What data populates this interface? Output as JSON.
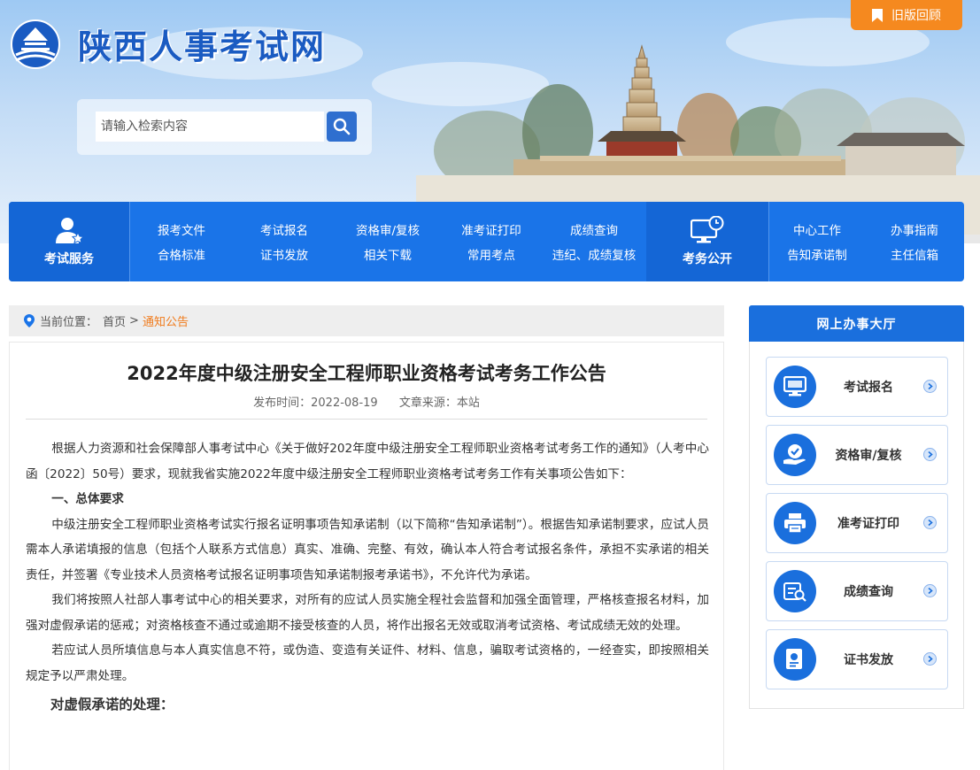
{
  "header": {
    "site_title": "陕西人事考试网",
    "old_version_label": "旧版回顾",
    "search": {
      "placeholder": "请输入检索内容",
      "value": ""
    }
  },
  "nav": {
    "exam_service_label": "考试服务",
    "exam_affairs_label": "考务公开",
    "service_links": [
      [
        "报考文件",
        "合格标准"
      ],
      [
        "考试报名",
        "证书发放"
      ],
      [
        "资格审/复核",
        "相关下载"
      ],
      [
        "准考证打印",
        "常用考点"
      ],
      [
        "成绩查询",
        "违纪、成绩复核"
      ]
    ],
    "affairs_links": [
      [
        "中心工作",
        "告知承诺制"
      ],
      [
        "办事指南",
        "主任信箱"
      ]
    ]
  },
  "breadcrumb": {
    "label": "当前位置：",
    "home": "首页",
    "separator": ">",
    "current": "通知公告"
  },
  "article": {
    "title": "2022年度中级注册安全工程师职业资格考试考务工作公告",
    "publish_time": "发布时间：2022-08-19",
    "source": "文章来源：本站",
    "paragraphs": [
      "根据人力资源和社会保障部人事考试中心《关于做好202年度中级注册安全工程师职业资格考试考务工作的通知》（人考中心函〔2022〕50号）要求，现就我省实施2022年度中级注册安全工程师职业资格考试考务工作有关事项公告如下：",
      "一、总体要求",
      "中级注册安全工程师职业资格考试实行报名证明事项告知承诺制（以下简称“告知承诺制”）。根据告知承诺制要求，应试人员需本人承诺填报的信息（包括个人联系方式信息）真实、准确、完整、有效，确认本人符合考试报名条件，承担不实承诺的相关责任，并签署《专业技术人员资格考试报名证明事项告知承诺制报考承诺书》，不允许代为承诺。",
      "我们将按照人社部人事考试中心的相关要求，对所有的应试人员实施全程社会监督和加强全面管理，严格核查报名材料，加强对虚假承诺的惩戒；对资格核查不通过或逾期不接受核查的人员，将作出报名无效或取消考试资格、考试成绩无效的处理。",
      "若应试人员所填信息与本人真实信息不符，或伪造、变造有关证件、材料、信息，骗取考试资格的，一经查实，即按照相关规定予以严肃处理。",
      "对虚假承诺的处理："
    ]
  },
  "sidebar": {
    "title": "网上办事大厅",
    "items": [
      {
        "label": "考试报名",
        "icon": "monitor-icon"
      },
      {
        "label": "资格审/复核",
        "icon": "hand-check-icon"
      },
      {
        "label": "准考证打印",
        "icon": "printer-icon"
      },
      {
        "label": "成绩查询",
        "icon": "search-document-icon"
      },
      {
        "label": "证书发放",
        "icon": "certificate-icon"
      }
    ]
  },
  "colors": {
    "primary_blue": "#1a74e8",
    "title_blue": "#1a5bc2",
    "accent_orange": "#f5891f",
    "breadcrumb_current": "#f07b1c"
  }
}
